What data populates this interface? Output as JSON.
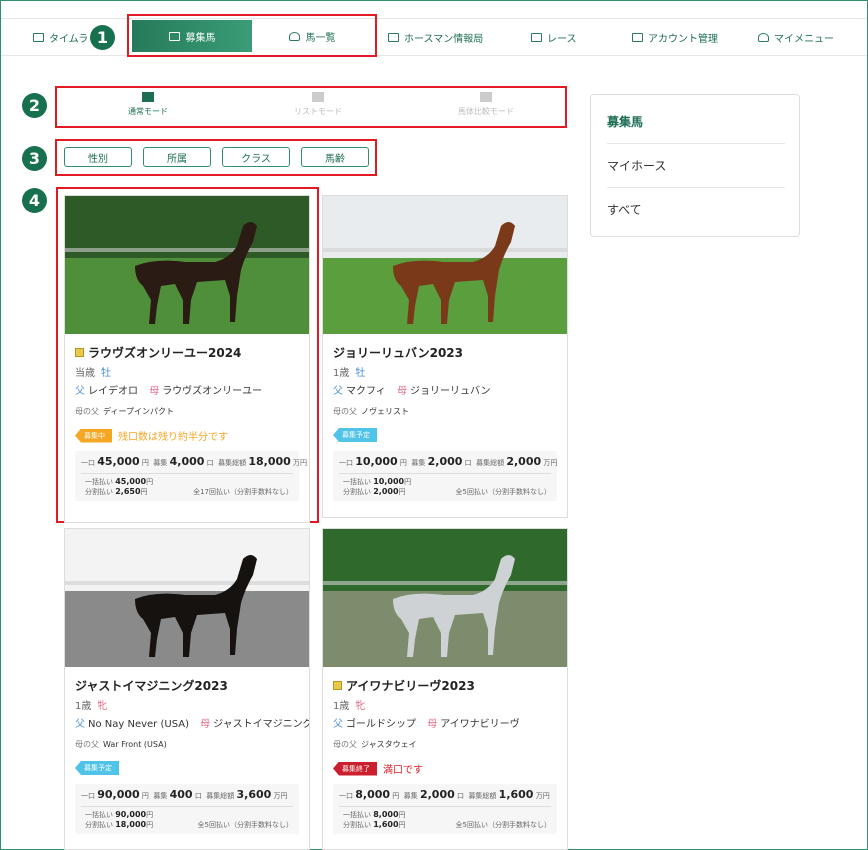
{
  "nav": {
    "items": [
      {
        "label": "タイムラ",
        "icon": "timeline-icon"
      },
      {
        "label": "ホースマン情報局",
        "icon": "info-icon"
      },
      {
        "label": "レース",
        "icon": "flag-icon"
      },
      {
        "label": "アカウント管理",
        "icon": "account-icon"
      },
      {
        "label": "マイメニュー",
        "icon": "user-icon"
      }
    ],
    "tabs": [
      {
        "label": "募集馬",
        "icon": "recruit-icon"
      },
      {
        "label": "馬一覧",
        "icon": "bell-icon"
      }
    ]
  },
  "annotations": [
    "1",
    "2",
    "3",
    "4"
  ],
  "modes": [
    {
      "label": "通常モード",
      "icon": "grid-mode-icon"
    },
    {
      "label": "リストモード",
      "icon": "list-mode-icon"
    },
    {
      "label": "馬体比較モード",
      "icon": "horse-compare-icon"
    }
  ],
  "filters": [
    "性別",
    "所属",
    "クラス",
    "馬齢"
  ],
  "sidebar": {
    "items": [
      "募集馬",
      "マイホース",
      "すべて"
    ]
  },
  "cards": [
    {
      "name": "ラウヴズオンリーユー2024",
      "has_icon": true,
      "age": "当歳",
      "sex": "牡",
      "sex_type": "m",
      "sire_label": "父",
      "sire": "レイデオロ",
      "dam_label": "母",
      "dam": "ラウヴズオンリーユー",
      "bms_label": "母の父",
      "bms": "ディープインパクト",
      "status": "募集中",
      "status_color": "orange",
      "note": "残口数は残り約半分です",
      "note_color": "orange",
      "unit_label": "一口",
      "unit_price": "45,000",
      "unit_suffix": "円",
      "count_label": "募集",
      "count": "4,000",
      "count_suffix": "口",
      "total_label": "募集総額",
      "total": "18,000",
      "total_suffix": "万円",
      "lump_label": "一括払い",
      "lump": "45,000",
      "lump_suffix": "円",
      "split_label": "分割払い",
      "split": "2,650",
      "split_suffix": "円",
      "plan": "全17回払い（分割手数料なし）",
      "colors": {
        "bg_top": "#2e5a28",
        "grass": "#4f8f3a",
        "horse": "#2a1c14"
      }
    },
    {
      "name": "ジョリーリュバン2023",
      "has_icon": false,
      "age": "1歳",
      "sex": "牡",
      "sex_type": "m",
      "sire_label": "父",
      "sire": "マクフィ",
      "dam_label": "母",
      "dam": "ジョリーリュバン",
      "bms_label": "母の父",
      "bms": "ノヴェリスト",
      "status": "募集予定",
      "status_color": "blue",
      "note": "",
      "note_color": "",
      "unit_label": "一口",
      "unit_price": "10,000",
      "unit_suffix": "円",
      "count_label": "募集",
      "count": "2,000",
      "count_suffix": "口",
      "total_label": "募集総額",
      "total": "2,000",
      "total_suffix": "万円",
      "lump_label": "一括払い",
      "lump": "10,000",
      "lump_suffix": "円",
      "split_label": "分割払い",
      "split": "2,000",
      "split_suffix": "円",
      "plan": "全5回払い（分割手数料なし）",
      "colors": {
        "bg_top": "#e9ecef",
        "grass": "#5a9e3d",
        "horse": "#7a3a1a"
      }
    },
    {
      "name": "ジャストイマジニング2023",
      "has_icon": false,
      "age": "1歳",
      "sex": "牝",
      "sex_type": "f",
      "sire_label": "父",
      "sire": "No Nay Never (USA)",
      "dam_label": "母",
      "dam": "ジャストイマジニング",
      "bms_label": "母の父",
      "bms": "War Front (USA)",
      "status": "募集予定",
      "status_color": "blue",
      "note": "",
      "note_color": "",
      "unit_label": "一口",
      "unit_price": "90,000",
      "unit_suffix": "円",
      "count_label": "募集",
      "count": "400",
      "count_suffix": "口",
      "total_label": "募集総額",
      "total": "3,600",
      "total_suffix": "万円",
      "lump_label": "一括払い",
      "lump": "90,000",
      "lump_suffix": "円",
      "split_label": "分割払い",
      "split": "18,000",
      "split_suffix": "円",
      "plan": "全5回払い（分割手数料なし）",
      "colors": {
        "bg_top": "#f3f3f3",
        "grass": "#8a8a8a",
        "horse": "#151210"
      }
    },
    {
      "name": "アイワナビリーヴ2023",
      "has_icon": true,
      "age": "1歳",
      "sex": "牝",
      "sex_type": "f",
      "sire_label": "父",
      "sire": "ゴールドシップ",
      "dam_label": "母",
      "dam": "アイワナビリーヴ",
      "bms_label": "母の父",
      "bms": "ジャスタウェイ",
      "status": "募集終了",
      "status_color": "red",
      "note": "満口です",
      "note_color": "red",
      "unit_label": "一口",
      "unit_price": "8,000",
      "unit_suffix": "円",
      "count_label": "募集",
      "count": "2,000",
      "count_suffix": "口",
      "total_label": "募集総額",
      "total": "1,600",
      "total_suffix": "万円",
      "lump_label": "一括払い",
      "lump": "8,000",
      "lump_suffix": "円",
      "split_label": "分割払い",
      "split": "1,600",
      "split_suffix": "円",
      "plan": "全5回払い（分割手数料なし）",
      "colors": {
        "bg_top": "#2f6a2c",
        "grass": "#7c8c6c",
        "horse": "#cfd2d4"
      }
    }
  ]
}
